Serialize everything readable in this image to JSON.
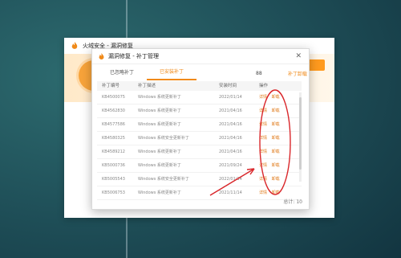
{
  "main_window": {
    "title": "火绒安全 - 漏洞修复",
    "footer_text": ""
  },
  "dialog": {
    "title": "漏洞修复 - 补丁管理",
    "tabs": [
      {
        "label": "已忽略补丁"
      },
      {
        "label": "已安装补丁"
      }
    ],
    "tab_count": "88",
    "tab_link": "补丁卸载",
    "table": {
      "headers": [
        "补丁编号",
        "补丁描述",
        "安装时间",
        "操作"
      ],
      "rows": [
        {
          "id": "KB4500075",
          "desc": "Windows 系统更新补丁",
          "date": "2022/01/14",
          "ops": [
            "详情",
            "卸载"
          ]
        },
        {
          "id": "KB4562830",
          "desc": "Windows 系统更新补丁",
          "date": "2021/04/16",
          "ops": [
            "详情",
            "卸载"
          ]
        },
        {
          "id": "KB4577586",
          "desc": "Windows 系统更新补丁",
          "date": "2021/04/16",
          "ops": [
            "详情",
            "卸载"
          ]
        },
        {
          "id": "KB4580325",
          "desc": "Windows 系统安全更新补丁",
          "date": "2021/04/16",
          "ops": [
            "详情",
            "卸载"
          ]
        },
        {
          "id": "KB4589212",
          "desc": "Windows 系统更新补丁",
          "date": "2021/04/16",
          "ops": [
            "详情",
            "卸载"
          ]
        },
        {
          "id": "KB5000736",
          "desc": "Windows 系统更新补丁",
          "date": "2021/09/24",
          "ops": [
            "详情",
            "卸载"
          ]
        },
        {
          "id": "KB5005543",
          "desc": "Windows 系统安全更新补丁",
          "date": "2022/01/14",
          "ops": [
            "详情",
            "卸载"
          ]
        },
        {
          "id": "KB5006753",
          "desc": "Windows 系统更新补丁",
          "date": "2021/11/14",
          "ops": [
            "详情",
            "卸载"
          ]
        }
      ]
    },
    "footer": "总计: 10"
  },
  "colors": {
    "accent": "#f08a1a",
    "annotation": "#d9262a"
  }
}
